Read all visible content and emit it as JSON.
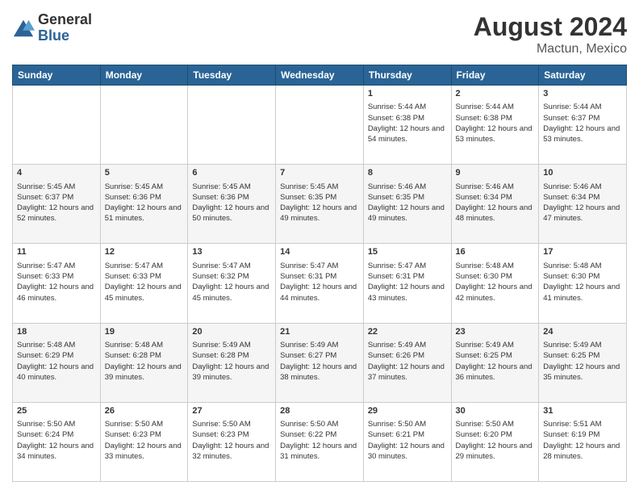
{
  "header": {
    "logo_general": "General",
    "logo_blue": "Blue",
    "month_year": "August 2024",
    "location": "Mactun, Mexico"
  },
  "days_of_week": [
    "Sunday",
    "Monday",
    "Tuesday",
    "Wednesday",
    "Thursday",
    "Friday",
    "Saturday"
  ],
  "weeks": [
    [
      {
        "day": "",
        "sunrise": "",
        "sunset": "",
        "daylight": ""
      },
      {
        "day": "",
        "sunrise": "",
        "sunset": "",
        "daylight": ""
      },
      {
        "day": "",
        "sunrise": "",
        "sunset": "",
        "daylight": ""
      },
      {
        "day": "",
        "sunrise": "",
        "sunset": "",
        "daylight": ""
      },
      {
        "day": "1",
        "sunrise": "5:44 AM",
        "sunset": "6:38 PM",
        "daylight": "12 hours and 54 minutes."
      },
      {
        "day": "2",
        "sunrise": "5:44 AM",
        "sunset": "6:38 PM",
        "daylight": "12 hours and 53 minutes."
      },
      {
        "day": "3",
        "sunrise": "5:44 AM",
        "sunset": "6:37 PM",
        "daylight": "12 hours and 53 minutes."
      }
    ],
    [
      {
        "day": "4",
        "sunrise": "5:45 AM",
        "sunset": "6:37 PM",
        "daylight": "12 hours and 52 minutes."
      },
      {
        "day": "5",
        "sunrise": "5:45 AM",
        "sunset": "6:36 PM",
        "daylight": "12 hours and 51 minutes."
      },
      {
        "day": "6",
        "sunrise": "5:45 AM",
        "sunset": "6:36 PM",
        "daylight": "12 hours and 50 minutes."
      },
      {
        "day": "7",
        "sunrise": "5:45 AM",
        "sunset": "6:35 PM",
        "daylight": "12 hours and 49 minutes."
      },
      {
        "day": "8",
        "sunrise": "5:46 AM",
        "sunset": "6:35 PM",
        "daylight": "12 hours and 49 minutes."
      },
      {
        "day": "9",
        "sunrise": "5:46 AM",
        "sunset": "6:34 PM",
        "daylight": "12 hours and 48 minutes."
      },
      {
        "day": "10",
        "sunrise": "5:46 AM",
        "sunset": "6:34 PM",
        "daylight": "12 hours and 47 minutes."
      }
    ],
    [
      {
        "day": "11",
        "sunrise": "5:47 AM",
        "sunset": "6:33 PM",
        "daylight": "12 hours and 46 minutes."
      },
      {
        "day": "12",
        "sunrise": "5:47 AM",
        "sunset": "6:33 PM",
        "daylight": "12 hours and 45 minutes."
      },
      {
        "day": "13",
        "sunrise": "5:47 AM",
        "sunset": "6:32 PM",
        "daylight": "12 hours and 45 minutes."
      },
      {
        "day": "14",
        "sunrise": "5:47 AM",
        "sunset": "6:31 PM",
        "daylight": "12 hours and 44 minutes."
      },
      {
        "day": "15",
        "sunrise": "5:47 AM",
        "sunset": "6:31 PM",
        "daylight": "12 hours and 43 minutes."
      },
      {
        "day": "16",
        "sunrise": "5:48 AM",
        "sunset": "6:30 PM",
        "daylight": "12 hours and 42 minutes."
      },
      {
        "day": "17",
        "sunrise": "5:48 AM",
        "sunset": "6:30 PM",
        "daylight": "12 hours and 41 minutes."
      }
    ],
    [
      {
        "day": "18",
        "sunrise": "5:48 AM",
        "sunset": "6:29 PM",
        "daylight": "12 hours and 40 minutes."
      },
      {
        "day": "19",
        "sunrise": "5:48 AM",
        "sunset": "6:28 PM",
        "daylight": "12 hours and 39 minutes."
      },
      {
        "day": "20",
        "sunrise": "5:49 AM",
        "sunset": "6:28 PM",
        "daylight": "12 hours and 39 minutes."
      },
      {
        "day": "21",
        "sunrise": "5:49 AM",
        "sunset": "6:27 PM",
        "daylight": "12 hours and 38 minutes."
      },
      {
        "day": "22",
        "sunrise": "5:49 AM",
        "sunset": "6:26 PM",
        "daylight": "12 hours and 37 minutes."
      },
      {
        "day": "23",
        "sunrise": "5:49 AM",
        "sunset": "6:25 PM",
        "daylight": "12 hours and 36 minutes."
      },
      {
        "day": "24",
        "sunrise": "5:49 AM",
        "sunset": "6:25 PM",
        "daylight": "12 hours and 35 minutes."
      }
    ],
    [
      {
        "day": "25",
        "sunrise": "5:50 AM",
        "sunset": "6:24 PM",
        "daylight": "12 hours and 34 minutes."
      },
      {
        "day": "26",
        "sunrise": "5:50 AM",
        "sunset": "6:23 PM",
        "daylight": "12 hours and 33 minutes."
      },
      {
        "day": "27",
        "sunrise": "5:50 AM",
        "sunset": "6:23 PM",
        "daylight": "12 hours and 32 minutes."
      },
      {
        "day": "28",
        "sunrise": "5:50 AM",
        "sunset": "6:22 PM",
        "daylight": "12 hours and 31 minutes."
      },
      {
        "day": "29",
        "sunrise": "5:50 AM",
        "sunset": "6:21 PM",
        "daylight": "12 hours and 30 minutes."
      },
      {
        "day": "30",
        "sunrise": "5:50 AM",
        "sunset": "6:20 PM",
        "daylight": "12 hours and 29 minutes."
      },
      {
        "day": "31",
        "sunrise": "5:51 AM",
        "sunset": "6:19 PM",
        "daylight": "12 hours and 28 minutes."
      }
    ]
  ]
}
